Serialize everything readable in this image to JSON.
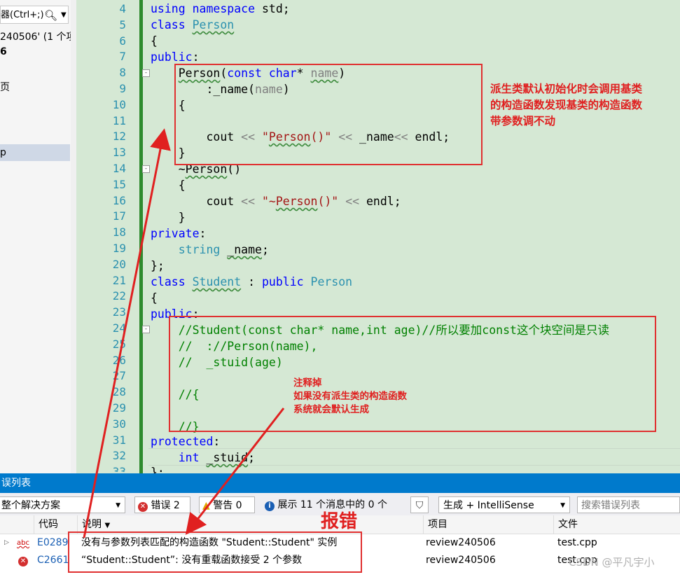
{
  "sidebar": {
    "search_text": "器(Ctrl+;)",
    "items": [
      "240506' (1 个项",
      "6",
      "页",
      "p"
    ]
  },
  "editor": {
    "lines": [
      {
        "n": "4"
      },
      {
        "n": "5"
      },
      {
        "n": "6"
      },
      {
        "n": "7"
      },
      {
        "n": "8"
      },
      {
        "n": "9"
      },
      {
        "n": "10"
      },
      {
        "n": "11"
      },
      {
        "n": "12"
      },
      {
        "n": "13"
      },
      {
        "n": "14"
      },
      {
        "n": "15"
      },
      {
        "n": "16"
      },
      {
        "n": "17"
      },
      {
        "n": "18"
      },
      {
        "n": "19"
      },
      {
        "n": "20"
      },
      {
        "n": "21"
      },
      {
        "n": "22"
      },
      {
        "n": "23"
      },
      {
        "n": "24"
      },
      {
        "n": "25"
      },
      {
        "n": "26"
      },
      {
        "n": "27"
      },
      {
        "n": "28"
      },
      {
        "n": "29"
      },
      {
        "n": "30"
      },
      {
        "n": "31"
      },
      {
        "n": "32"
      },
      {
        "n": "33"
      }
    ]
  },
  "annotations": {
    "note1": "派生类默认初始化时会调用基类\n的构造函数发现基类的构造函数\n带参数调不动",
    "note2": "注释掉\n如果没有派生类的构造函数\n系统就会默认生成",
    "error_label": "报错"
  },
  "error_list": {
    "title": "误列表",
    "scope": "整个解决方案",
    "errors_btn": "错误 2",
    "warnings_btn": "警告 0",
    "messages_btn": "展示 11 个消息中的 0 个",
    "build_filter": "生成 + IntelliSense",
    "search_placeholder": "搜索错误列表",
    "columns": {
      "code": "代码",
      "desc": "说明",
      "project": "项目",
      "file": "文件"
    },
    "rows": [
      {
        "code": "E0289",
        "desc": "没有与参数列表匹配的构造函数 \"Student::Student\" 实例",
        "project": "review240506",
        "file": "test.cpp"
      },
      {
        "code": "C2661",
        "desc": "“Student::Student”: 没有重载函数接受 2 个参数",
        "project": "review240506",
        "file": "test.cpp"
      }
    ]
  },
  "watermark": "CSDN @平凡宇小"
}
